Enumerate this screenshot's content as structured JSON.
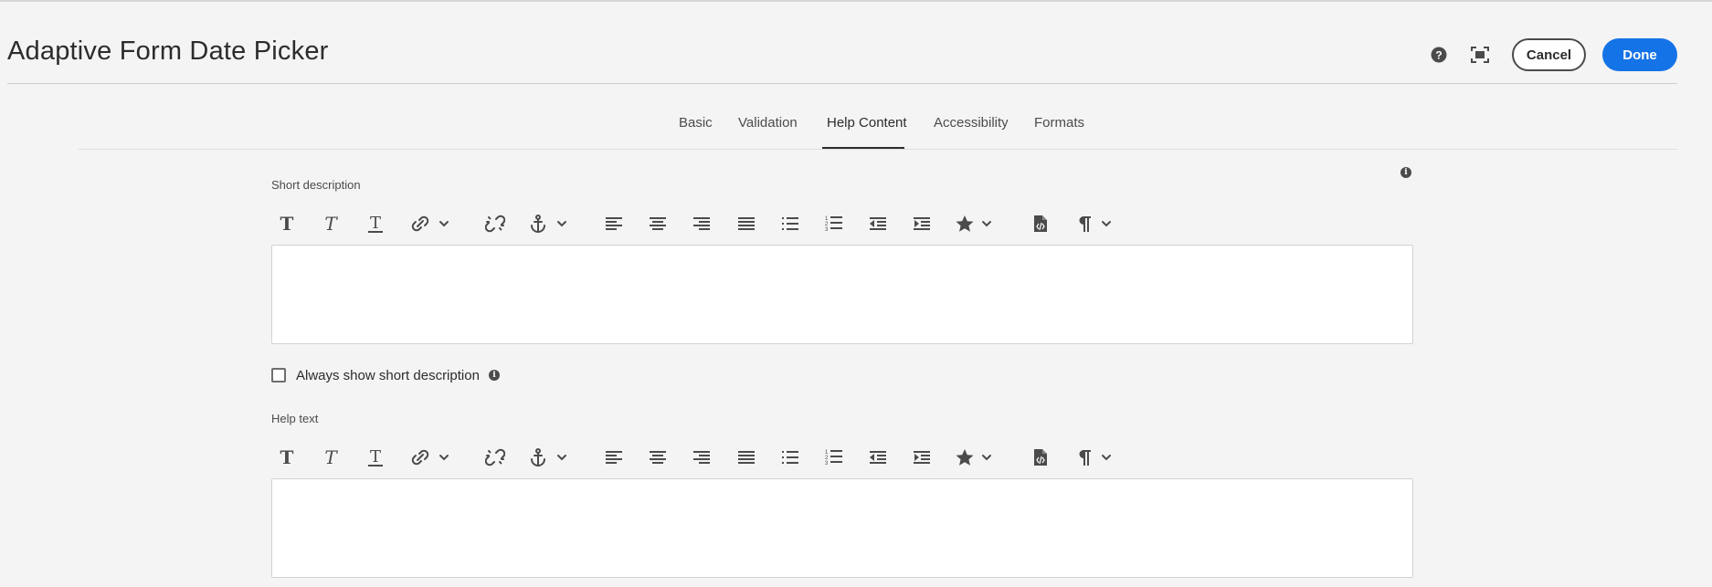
{
  "dialog": {
    "title": "Adaptive Form Date Picker",
    "help_icon": "help-circle-icon",
    "fullscreen_icon": "fullscreen-icon",
    "cancel_label": "Cancel",
    "done_label": "Done",
    "accent_color": "#1473e6"
  },
  "tabs": [
    {
      "label": "Basic",
      "active": false
    },
    {
      "label": "Validation",
      "active": false
    },
    {
      "label": "Help Content",
      "active": true
    },
    {
      "label": "Accessibility",
      "active": false
    },
    {
      "label": "Formats",
      "active": false
    }
  ],
  "short_description": {
    "label": "Short description",
    "value": ""
  },
  "always_show": {
    "label": "Always show short description",
    "checked": false
  },
  "help_text": {
    "label": "Help text",
    "value": ""
  },
  "toolbar_icons": [
    "bold-icon",
    "italic-icon",
    "underline-icon",
    "link-icon",
    "unlink-icon",
    "anchor-icon",
    "align-left-icon",
    "align-center-icon",
    "align-right-icon",
    "justify-icon",
    "bullet-list-icon",
    "numbered-list-icon",
    "outdent-icon",
    "indent-icon",
    "special-char-icon",
    "source-edit-icon",
    "paragraph-format-icon"
  ]
}
